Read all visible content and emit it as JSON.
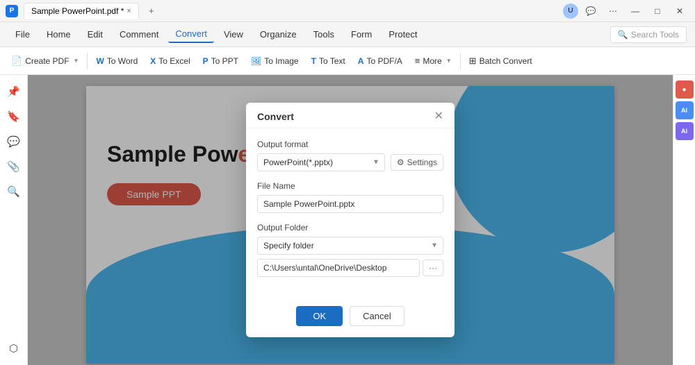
{
  "titleBar": {
    "appName": "Sample PowerPoint.pdf *",
    "closeTab": "×",
    "newTab": "+",
    "windowButtons": {
      "minimize": "—",
      "maximize": "□",
      "close": "✕"
    },
    "userAvatar": "U",
    "chatIcon": "💬",
    "menuIcon": "⋯"
  },
  "menuBar": {
    "items": [
      {
        "label": "File",
        "active": false
      },
      {
        "label": "Home",
        "active": false
      },
      {
        "label": "Edit",
        "active": false
      },
      {
        "label": "Comment",
        "active": false
      },
      {
        "label": "Convert",
        "active": true
      },
      {
        "label": "View",
        "active": false
      },
      {
        "label": "Organize",
        "active": false
      },
      {
        "label": "Tools",
        "active": false
      },
      {
        "label": "Form",
        "active": false
      },
      {
        "label": "Protect",
        "active": false
      }
    ],
    "searchPlaceholder": "Search Tools"
  },
  "toolbar": {
    "buttons": [
      {
        "id": "create-pdf",
        "icon": "📄",
        "label": "Create PDF",
        "hasArrow": true
      },
      {
        "id": "to-word",
        "icon": "W",
        "label": "To Word"
      },
      {
        "id": "to-excel",
        "icon": "X",
        "label": "To Excel"
      },
      {
        "id": "to-ppt",
        "icon": "P",
        "label": "To PPT"
      },
      {
        "id": "to-image",
        "icon": "🖼",
        "label": "To Image"
      },
      {
        "id": "to-text",
        "icon": "T",
        "label": "To Text"
      },
      {
        "id": "to-pdfa",
        "icon": "A",
        "label": "To PDF/A"
      },
      {
        "id": "more",
        "icon": "≡",
        "label": "More",
        "hasArrow": true
      },
      {
        "id": "batch-convert",
        "icon": "⊞",
        "label": "Batch Convert"
      }
    ]
  },
  "sidebar": {
    "icons": [
      "📌",
      "🔖",
      "💬",
      "📎",
      "🔍",
      "⬡"
    ]
  },
  "rightPanel": {
    "icons": [
      "🔴",
      "A",
      "A"
    ]
  },
  "pdfContent": {
    "titleNormal": "Sample Pow",
    "titleRed": "erPoint",
    "buttonLabel": "Sample PPT"
  },
  "modal": {
    "title": "Convert",
    "outputFormatLabel": "Output format",
    "outputFormatValue": "PowerPoint(*.pptx)",
    "settingsLabel": "Settings",
    "fileNameLabel": "File Name",
    "fileNameValue": "Sample PowerPoint.pptx",
    "outputFolderLabel": "Output Folder",
    "folderOption": "Specify folder",
    "folderPath": "C:\\Users\\untal\\OneDrive\\Desktop",
    "folderBtnLabel": "···",
    "okLabel": "OK",
    "cancelLabel": "Cancel"
  }
}
